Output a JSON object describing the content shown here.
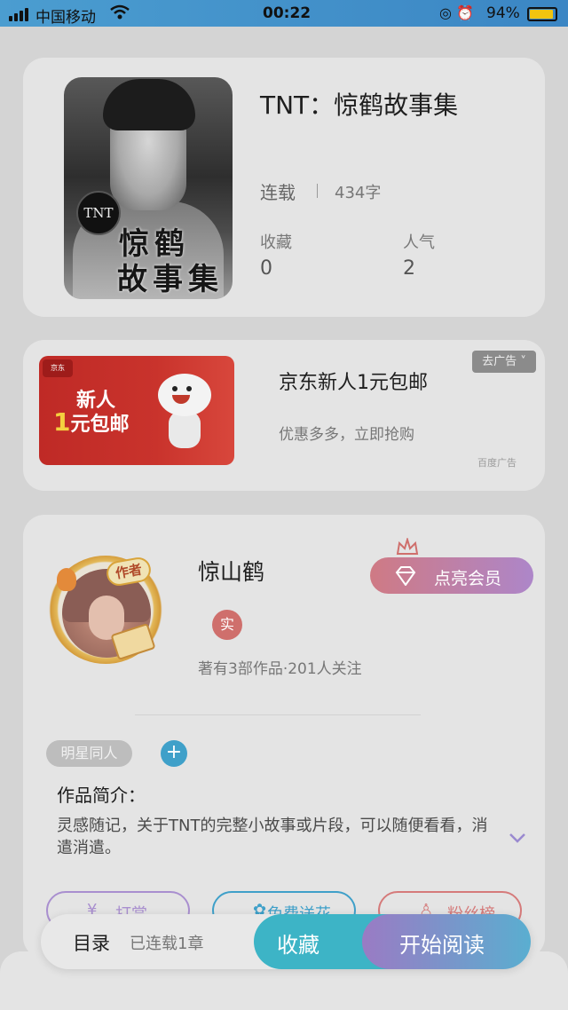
{
  "status_bar": {
    "carrier": "中国移动",
    "time": "00:22",
    "battery_pct": "94%"
  },
  "book": {
    "title": "TNT：惊鹤故事集",
    "status": "连载",
    "word_count": "434字",
    "favorites_label": "收藏",
    "favorites_value": "0",
    "popularity_label": "人气",
    "popularity_value": "2",
    "cover": {
      "badge": "TNT",
      "line1": "惊鹤",
      "line2": "故事集"
    }
  },
  "ad": {
    "image_line1": "新人",
    "image_line2_num": "1",
    "image_line2_text": "元包邮",
    "title": "京东新人1元包邮",
    "subtitle": "优惠多多，立即抢购",
    "remove_label": "去广告",
    "source": "百度广告"
  },
  "author": {
    "name": "惊山鹤",
    "role_tag": "作者",
    "verified_badge": "实",
    "stats": "著有3部作品·201人关注",
    "vip_button": "点亮会员"
  },
  "tags": {
    "items": [
      "明星同人"
    ],
    "add_label": "+"
  },
  "intro": {
    "heading": "作品简介：",
    "body": "灵感随记，关于TNT的完整小故事或片段，可以随便看看，消遣消遣。"
  },
  "actions": {
    "reward": "打赏",
    "flowers": "免费送花",
    "fans": "粉丝榜"
  },
  "bottom_bar": {
    "toc": "目录",
    "toc_status": "已连载1章",
    "favorite": "收藏",
    "start_reading": "开始阅读"
  },
  "colors": {
    "accent_teal": "#3db4c6",
    "accent_purple": "#9a7bc4",
    "vip_gradient_start": "#cf7a84",
    "ad_red": "#c9332c"
  }
}
